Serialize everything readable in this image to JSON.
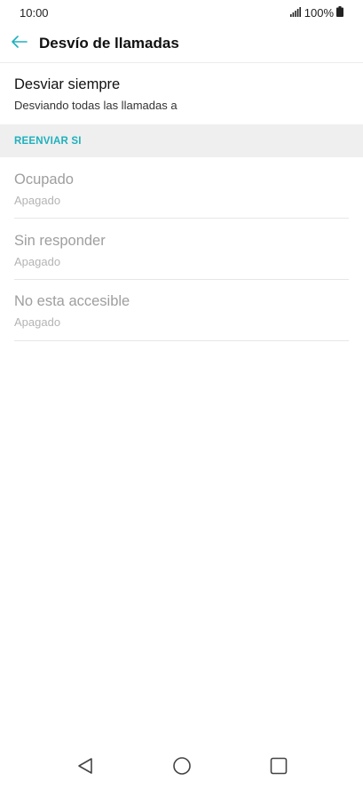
{
  "status_bar": {
    "time": "10:00",
    "battery": "100%"
  },
  "app_bar": {
    "title": "Desvío de llamadas",
    "back_icon": "arrow-left-icon"
  },
  "always_forward": {
    "title": "Desviar siempre",
    "subtitle": "Desviando todas las llamadas a"
  },
  "section": {
    "title": "REENVIAR SI"
  },
  "conditional_items": [
    {
      "title": "Ocupado",
      "subtitle": "Apagado"
    },
    {
      "title": "Sin responder",
      "subtitle": "Apagado"
    },
    {
      "title": "No esta accesible",
      "subtitle": "Apagado"
    }
  ],
  "nav_bar": {
    "back_icon": "triangle-back-icon",
    "home_icon": "circle-home-icon",
    "recent_icon": "square-recent-icon"
  },
  "colors": {
    "accent": "#1fb0bd",
    "section_bg": "#efefef",
    "disabled_text": "#9e9e9e"
  }
}
